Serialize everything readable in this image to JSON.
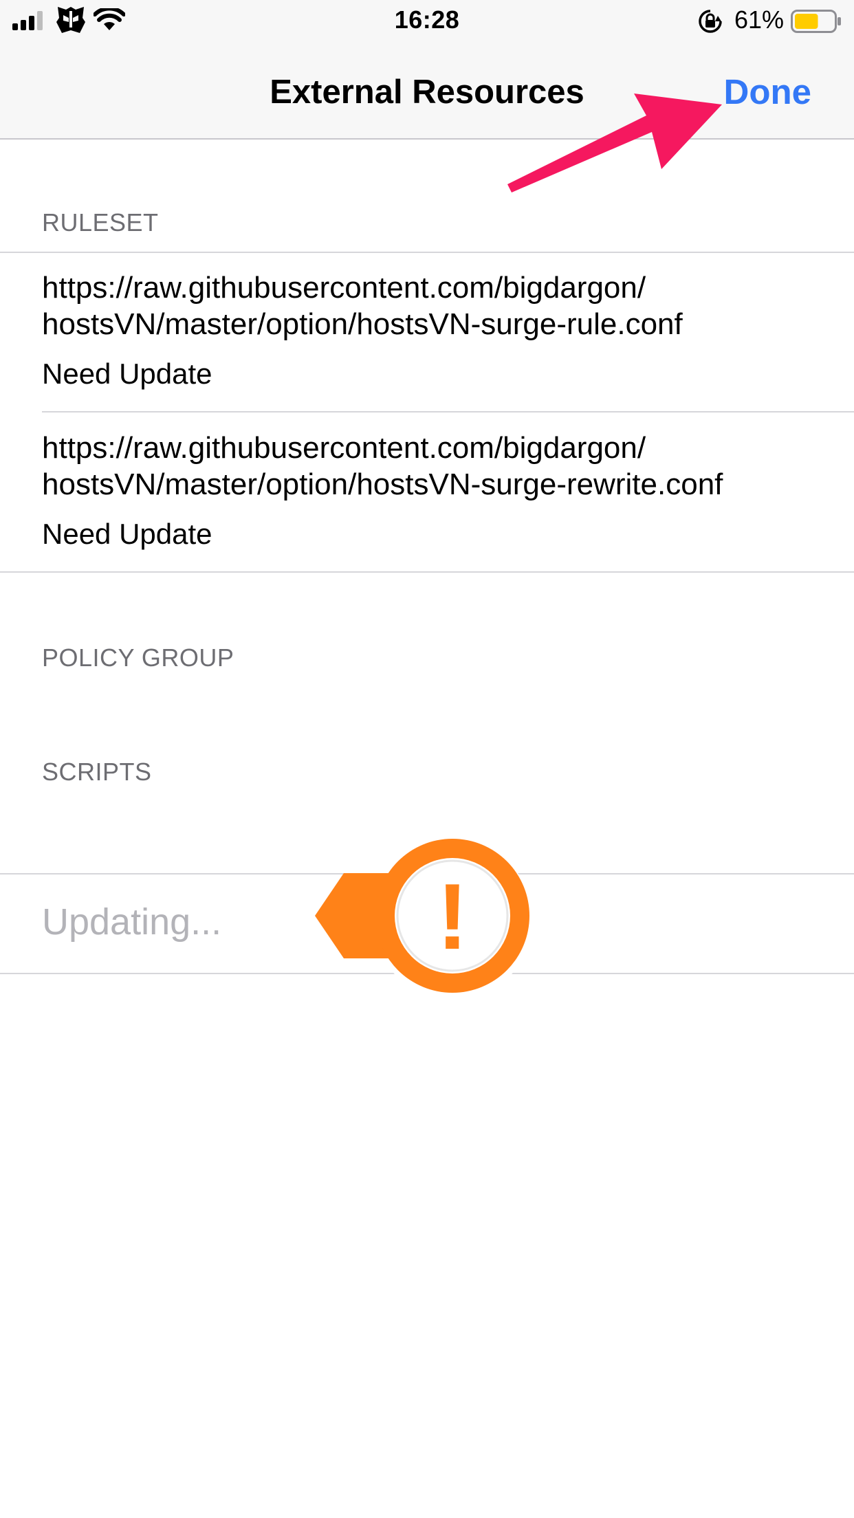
{
  "status_bar": {
    "time": "16:28",
    "battery_percent": "61%",
    "battery_level": 0.61,
    "icons": [
      "cellular-signal-icon",
      "transformers-autobot-icon",
      "wifi-icon",
      "rotation-lock-icon",
      "battery-icon"
    ]
  },
  "nav": {
    "title": "External Resources",
    "done_label": "Done",
    "done_color": "#3478f6"
  },
  "sections": {
    "ruleset": {
      "header": "RULESET",
      "items": [
        {
          "url_line1": "https://raw.githubusercontent.com/bigdargon/",
          "url_line2": "hostsVN/master/option/hostsVN-surge-rule.conf",
          "status": "Need Update"
        },
        {
          "url_line1": "https://raw.githubusercontent.com/bigdargon/",
          "url_line2": "hostsVN/master/option/hostsVN-surge-rewrite.conf",
          "status": "Need Update"
        }
      ]
    },
    "policy_group": {
      "header": "POLICY GROUP"
    },
    "scripts": {
      "header": "SCRIPTS"
    }
  },
  "updating": {
    "label": "Updating..."
  },
  "annotations": {
    "arrow": {
      "icon": "pointer-arrow-icon",
      "color": "#f5185f"
    },
    "badge": {
      "icon": "exclamation-icon",
      "glyph": "!",
      "color": "#ff8218"
    }
  }
}
